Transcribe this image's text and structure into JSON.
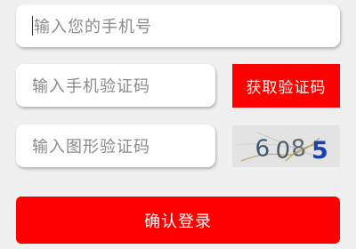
{
  "form": {
    "phone_placeholder": "输入您的手机号",
    "sms_code_placeholder": "输入手机验证码",
    "image_code_placeholder": "输入图形验证码",
    "get_sms_code_label": "获取验证码",
    "captcha": {
      "digits": [
        "6",
        "0",
        "8",
        "5"
      ]
    },
    "confirm_label": "确认登录"
  },
  "colors": {
    "accent": "#ff0000",
    "background": "#f0f0f0",
    "field_background": "#ffffff",
    "placeholder_text": "#8a8a8a",
    "captcha_background": "#e3e3e3",
    "captcha_digit_gray": "#3d5a6e",
    "captcha_digit_blue": "#1a3fb0"
  }
}
